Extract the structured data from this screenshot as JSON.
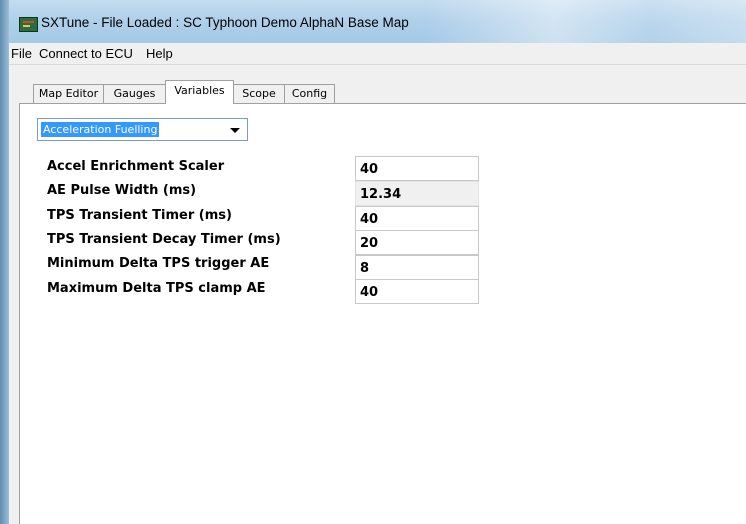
{
  "window": {
    "title": "SXTune - File Loaded :  SC Typhoon Demo AlphaN Base Map"
  },
  "menu": {
    "items": [
      "File",
      "Connect to ECU",
      "Help"
    ]
  },
  "tabs": [
    {
      "label": "Map Editor",
      "active": false
    },
    {
      "label": "Gauges",
      "active": false
    },
    {
      "label": "Variables",
      "active": true
    },
    {
      "label": "Scope",
      "active": false
    },
    {
      "label": "Config",
      "active": false
    }
  ],
  "category": {
    "selected": "Acceleration Fuelling"
  },
  "variables": [
    {
      "label": "Accel Enrichment Scaler",
      "value": "40",
      "readonly": false
    },
    {
      "label": "AE Pulse Width (ms)",
      "value": "12.34",
      "readonly": true
    },
    {
      "label": "TPS Transient Timer (ms)",
      "value": "40",
      "readonly": false
    },
    {
      "label": "TPS Transient Decay Timer (ms)",
      "value": "20",
      "readonly": false
    },
    {
      "label": "Minimum Delta TPS trigger AE",
      "value": "8",
      "readonly": false
    },
    {
      "label": "Maximum Delta TPS clamp AE",
      "value": "40",
      "readonly": false
    }
  ]
}
